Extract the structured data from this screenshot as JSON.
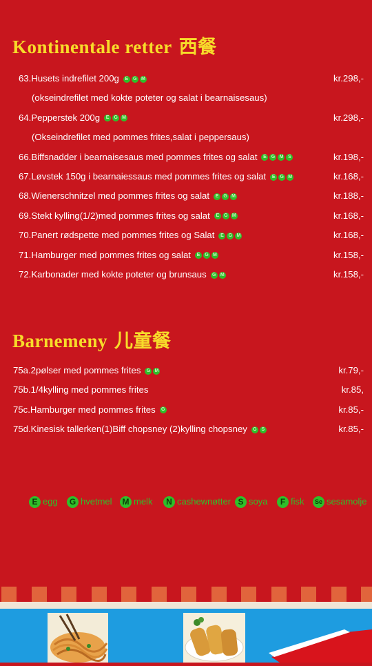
{
  "sections": {
    "continental": {
      "title": "Kontinentale retter",
      "title_cn": "西餐",
      "items": [
        {
          "text": "63.Husets indrefilet 200g",
          "tags": [
            "E",
            "G",
            "M"
          ],
          "price": "kr.298,-"
        },
        {
          "text": "(okseindrefilet med kokte poteter og salat i bearnaisesaus)"
        },
        {
          "text": "64.Pepperstek 200g",
          "tags": [
            "E",
            "G",
            "M"
          ],
          "price": "kr.298,-"
        },
        {
          "text": "(Okseindrefilet med pommes frites,salat i peppersaus)"
        },
        {
          "text": "66.Biffsnadder i bearnaisesaus med pommes frites og salat",
          "tags": [
            "E",
            "G",
            "M",
            "S"
          ],
          "price": "kr.198,-"
        },
        {
          "text": "67.Løvstek 150g i bearnaiessaus med pommes frites og salat",
          "tags": [
            "E",
            "G",
            "M"
          ],
          "price": "kr.168,-"
        },
        {
          "text": "68.Wienerschnitzel med pommes frites og salat",
          "tags": [
            "E",
            "G",
            "M"
          ],
          "price": "kr.188,-"
        },
        {
          "text": "69.Stekt kylling(1/2)med pommes frites og salat",
          "tags": [
            "E",
            "G",
            "M"
          ],
          "price": "kr.168,-"
        },
        {
          "text": "70.Panert rødspette med pommes frites og Salat",
          "tags": [
            "E",
            "G",
            "M"
          ],
          "price": "kr.168,-"
        },
        {
          "text": "71.Hamburger med pommes frites og salat",
          "tags": [
            "E",
            "G",
            "M"
          ],
          "price": "kr.158,-"
        },
        {
          "text": "72.Karbonader med kokte poteter og brunsaus",
          "tags": [
            "G",
            "M"
          ],
          "price": "kr.158,-"
        }
      ]
    },
    "kids": {
      "title": "Barnemeny",
      "title_cn": "儿童餐",
      "items": [
        {
          "text": "75a.2pølser med pommes frites",
          "tags": [
            "G",
            "M"
          ],
          "price": "kr.79,-"
        },
        {
          "text": "75b.1/4kylling med pommes frites",
          "tags": [],
          "price": "kr.85,"
        },
        {
          "text": "75c.Hamburger med pommes frites",
          "tags": [
            "G"
          ],
          "price": "kr.85,-"
        },
        {
          "text": "75d.Kinesisk tallerken(1)Biff chopsney (2)kylling chopsney",
          "tags": [
            "G",
            "S"
          ],
          "price": "kr.85,-"
        }
      ]
    }
  },
  "legend": [
    {
      "letter": "E",
      "label": "egg"
    },
    {
      "letter": "G",
      "label": "hvetmel"
    },
    {
      "letter": "M",
      "label": "melk"
    },
    {
      "letter": "N",
      "label": "cashewnøtter"
    },
    {
      "letter": "S",
      "label": "soya"
    },
    {
      "letter": "F",
      "label": "fisk"
    },
    {
      "letter": "Se",
      "label": "sesamolje"
    }
  ],
  "colors": {
    "background": "#c8161e",
    "title": "#f7dc2a",
    "allergen_green": "#2fbf2a",
    "banner_blue": "#1e9ce0",
    "strip_orange": "#e1643c"
  }
}
